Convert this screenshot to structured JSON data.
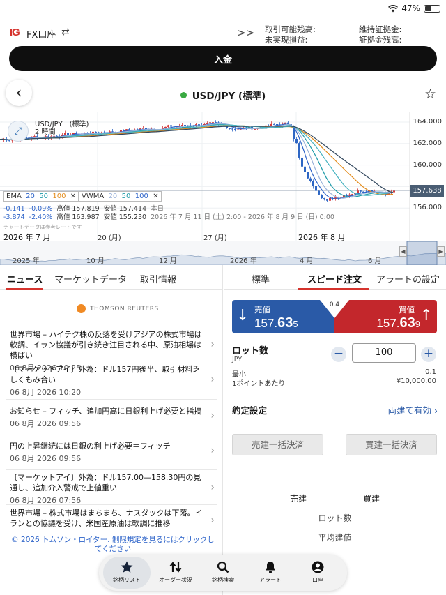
{
  "status": {
    "battery": "47%",
    "battery_level": 0.47
  },
  "account": {
    "brand": "IG",
    "name": "FX口座",
    "metrics": {
      "available": "取引可能残高:",
      "unrealized": "未実現損益:",
      "margin_held": "維持証拠金:",
      "margin_balance": "証拠金残高:"
    },
    "deposit_label": "入金"
  },
  "instrument": {
    "title": "USD/JPY (標準)"
  },
  "chart": {
    "symbol": "USD/JPY　(標準)",
    "interval": "2 時間",
    "ema": {
      "label": "EMA",
      "p1": "20",
      "p2": "50",
      "p3": "100",
      "close": "✕"
    },
    "vwma": {
      "label": "VWMA",
      "p1": "20",
      "p2": "50",
      "p3": "100",
      "close": "✕"
    },
    "row1": {
      "chg": "-0.141",
      "pct": "-0.09%",
      "high_label": "高値",
      "high": "157.819",
      "low_label": "安値",
      "low": "157.414",
      "period": "本日"
    },
    "row2": {
      "chg": "-3.874",
      "pct": "-2.40%",
      "high_label": "高値",
      "high": "163.987",
      "low_label": "安値",
      "low": "155.230",
      "range": "2026 年 7 月 11 日 (土) 2:00 - 2026 年 8 月 9 日 (日) 0:00"
    },
    "disclaimer": "チャートデータは参考レートです",
    "current_price": "157.638",
    "y_labels": [
      "164.000",
      "162.000",
      "160.000",
      "156.000"
    ],
    "x_labels": [
      "2026 年 7 月",
      "20 (月)",
      "27 (月)",
      "2026 年 8 月"
    ],
    "navigator_labels": [
      "2025 年",
      "10 月",
      "12 月",
      "2026 年",
      "4 月",
      "6 月"
    ],
    "nav_left": "◀",
    "nav_right": "▶"
  },
  "left_tabs": [
    "ニュース",
    "マーケットデータ",
    "取引情報"
  ],
  "news_source": "THOMSON REUTERS",
  "news": [
    {
      "title": "世界市場 – ハイテク株の反落を受けアジアの株式市場は軟調、イラン協議が引き続き注目される中、原油相場は横ばい",
      "date": "06 8月 2026 10:25"
    },
    {
      "title": "〔マーケットアイ〕外為：ドル157円後半、取引材料乏しくもみ合い",
      "date": "06 8月 2026 10:20"
    },
    {
      "title": "お知らせ – フィッチ、追加円高に日銀利上げ必要と指摘",
      "date": "06 8月 2026 09:56"
    },
    {
      "title": "円の上昇継続には日銀の利上げ必要＝フィッチ",
      "date": "06 8月 2026 09:56"
    },
    {
      "title": "〔マーケットアイ〕外為：ドル157.00―158.30円の見通し、追加介入警戒で上値重い",
      "date": "06 8月 2026 07:56"
    },
    {
      "title": "世界市場 – 株式市場はまちまち、ナスダックは下落。イランとの協議を受け、米国産原油は軟調に推移",
      "date": ""
    }
  ],
  "copyright": "© 2026 トムソン・ロイター. 制限規定を見るにはクリックしてください",
  "right_tabs": [
    "標準",
    "スピード注文",
    "アラートの設定"
  ],
  "quote": {
    "sell_label": "売値",
    "sell_head": "157.",
    "sell_big": "63",
    "sell_tail": "5",
    "buy_label": "買値",
    "buy_head": "157.",
    "buy_big": "63",
    "buy_tail": "9",
    "spread": "0.4"
  },
  "lot": {
    "label": "ロット数",
    "ccy": "JPY",
    "value": "100",
    "min_label": "最小",
    "min_value": "0.1",
    "per_point_label": "1ポイントあたり",
    "per_point_value": "¥10,000.00"
  },
  "order_setting": {
    "label": "約定設定",
    "value": "両建て有効"
  },
  "close_buttons": {
    "sell": "売建一括決済",
    "buy": "買建一括決済"
  },
  "positions": {
    "sell_head": "売建",
    "buy_head": "買建",
    "lots": "ロット数",
    "avg": "平均建値"
  },
  "bottom_nav": [
    "銘柄リスト",
    "オーダー状況",
    "銘柄検索",
    "アラート",
    "口座"
  ]
}
